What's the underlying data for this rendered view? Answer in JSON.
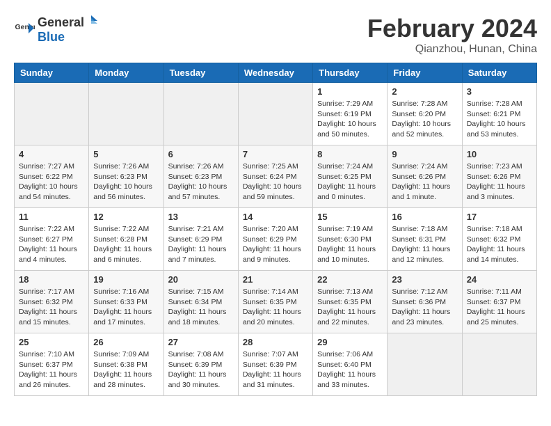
{
  "header": {
    "logo_general": "General",
    "logo_blue": "Blue",
    "month_year": "February 2024",
    "location": "Qianzhou, Hunan, China"
  },
  "days_of_week": [
    "Sunday",
    "Monday",
    "Tuesday",
    "Wednesday",
    "Thursday",
    "Friday",
    "Saturday"
  ],
  "weeks": [
    [
      {
        "day": "",
        "info": ""
      },
      {
        "day": "",
        "info": ""
      },
      {
        "day": "",
        "info": ""
      },
      {
        "day": "",
        "info": ""
      },
      {
        "day": "1",
        "info": "Sunrise: 7:29 AM\nSunset: 6:19 PM\nDaylight: 10 hours\nand 50 minutes."
      },
      {
        "day": "2",
        "info": "Sunrise: 7:28 AM\nSunset: 6:20 PM\nDaylight: 10 hours\nand 52 minutes."
      },
      {
        "day": "3",
        "info": "Sunrise: 7:28 AM\nSunset: 6:21 PM\nDaylight: 10 hours\nand 53 minutes."
      }
    ],
    [
      {
        "day": "4",
        "info": "Sunrise: 7:27 AM\nSunset: 6:22 PM\nDaylight: 10 hours\nand 54 minutes."
      },
      {
        "day": "5",
        "info": "Sunrise: 7:26 AM\nSunset: 6:23 PM\nDaylight: 10 hours\nand 56 minutes."
      },
      {
        "day": "6",
        "info": "Sunrise: 7:26 AM\nSunset: 6:23 PM\nDaylight: 10 hours\nand 57 minutes."
      },
      {
        "day": "7",
        "info": "Sunrise: 7:25 AM\nSunset: 6:24 PM\nDaylight: 10 hours\nand 59 minutes."
      },
      {
        "day": "8",
        "info": "Sunrise: 7:24 AM\nSunset: 6:25 PM\nDaylight: 11 hours\nand 0 minutes."
      },
      {
        "day": "9",
        "info": "Sunrise: 7:24 AM\nSunset: 6:26 PM\nDaylight: 11 hours\nand 1 minute."
      },
      {
        "day": "10",
        "info": "Sunrise: 7:23 AM\nSunset: 6:26 PM\nDaylight: 11 hours\nand 3 minutes."
      }
    ],
    [
      {
        "day": "11",
        "info": "Sunrise: 7:22 AM\nSunset: 6:27 PM\nDaylight: 11 hours\nand 4 minutes."
      },
      {
        "day": "12",
        "info": "Sunrise: 7:22 AM\nSunset: 6:28 PM\nDaylight: 11 hours\nand 6 minutes."
      },
      {
        "day": "13",
        "info": "Sunrise: 7:21 AM\nSunset: 6:29 PM\nDaylight: 11 hours\nand 7 minutes."
      },
      {
        "day": "14",
        "info": "Sunrise: 7:20 AM\nSunset: 6:29 PM\nDaylight: 11 hours\nand 9 minutes."
      },
      {
        "day": "15",
        "info": "Sunrise: 7:19 AM\nSunset: 6:30 PM\nDaylight: 11 hours\nand 10 minutes."
      },
      {
        "day": "16",
        "info": "Sunrise: 7:18 AM\nSunset: 6:31 PM\nDaylight: 11 hours\nand 12 minutes."
      },
      {
        "day": "17",
        "info": "Sunrise: 7:18 AM\nSunset: 6:32 PM\nDaylight: 11 hours\nand 14 minutes."
      }
    ],
    [
      {
        "day": "18",
        "info": "Sunrise: 7:17 AM\nSunset: 6:32 PM\nDaylight: 11 hours\nand 15 minutes."
      },
      {
        "day": "19",
        "info": "Sunrise: 7:16 AM\nSunset: 6:33 PM\nDaylight: 11 hours\nand 17 minutes."
      },
      {
        "day": "20",
        "info": "Sunrise: 7:15 AM\nSunset: 6:34 PM\nDaylight: 11 hours\nand 18 minutes."
      },
      {
        "day": "21",
        "info": "Sunrise: 7:14 AM\nSunset: 6:35 PM\nDaylight: 11 hours\nand 20 minutes."
      },
      {
        "day": "22",
        "info": "Sunrise: 7:13 AM\nSunset: 6:35 PM\nDaylight: 11 hours\nand 22 minutes."
      },
      {
        "day": "23",
        "info": "Sunrise: 7:12 AM\nSunset: 6:36 PM\nDaylight: 11 hours\nand 23 minutes."
      },
      {
        "day": "24",
        "info": "Sunrise: 7:11 AM\nSunset: 6:37 PM\nDaylight: 11 hours\nand 25 minutes."
      }
    ],
    [
      {
        "day": "25",
        "info": "Sunrise: 7:10 AM\nSunset: 6:37 PM\nDaylight: 11 hours\nand 26 minutes."
      },
      {
        "day": "26",
        "info": "Sunrise: 7:09 AM\nSunset: 6:38 PM\nDaylight: 11 hours\nand 28 minutes."
      },
      {
        "day": "27",
        "info": "Sunrise: 7:08 AM\nSunset: 6:39 PM\nDaylight: 11 hours\nand 30 minutes."
      },
      {
        "day": "28",
        "info": "Sunrise: 7:07 AM\nSunset: 6:39 PM\nDaylight: 11 hours\nand 31 minutes."
      },
      {
        "day": "29",
        "info": "Sunrise: 7:06 AM\nSunset: 6:40 PM\nDaylight: 11 hours\nand 33 minutes."
      },
      {
        "day": "",
        "info": ""
      },
      {
        "day": "",
        "info": ""
      }
    ]
  ]
}
